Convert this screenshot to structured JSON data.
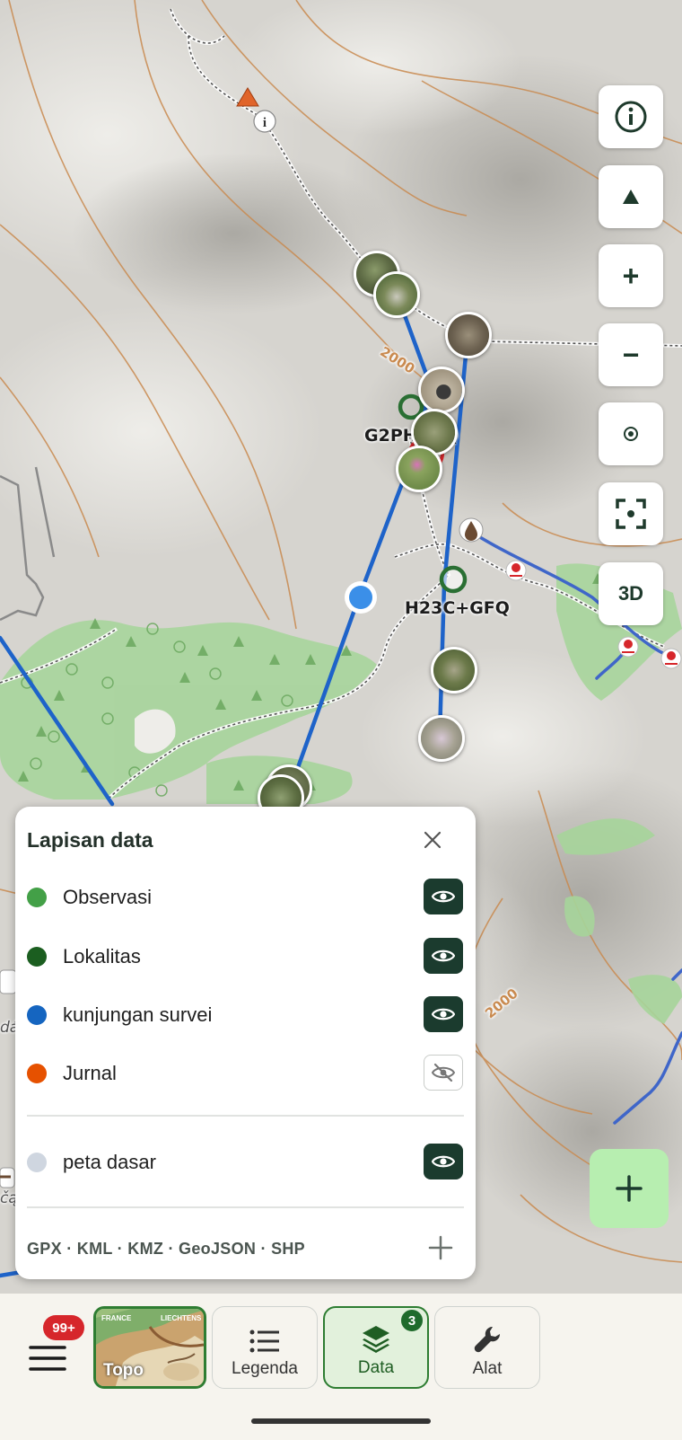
{
  "map": {
    "contour_label_1": "2000",
    "contour_label_2": "2000",
    "place_label_1": "G2PH+CQ",
    "place_label_2": "H23C+GFQ",
    "edge_text_1": "čą",
    "edge_text_2": "dá",
    "colors": {
      "track": "#1e63c9",
      "forest": "#a7d59b",
      "contour": "#c98a4f",
      "marker_green": "#2a6f33"
    }
  },
  "controls": {
    "info_icon": "info-icon",
    "north_icon": "north-arrow-icon",
    "zoom_in": "+",
    "zoom_out": "−",
    "locate_icon": "target-icon",
    "focus_icon": "focus-frame-icon",
    "three_d": "3D",
    "fab_icon": "plus-icon"
  },
  "panel": {
    "title": "Lapisan data",
    "layers": [
      {
        "name": "Observasi",
        "color": "#43a047",
        "visible": true
      },
      {
        "name": "Lokalitas",
        "color": "#1b5e20",
        "visible": true
      },
      {
        "name": "kunjungan survei",
        "color": "#1565c0",
        "visible": true
      },
      {
        "name": "Jurnal",
        "color": "#e65100",
        "visible": false
      }
    ],
    "base_layer": {
      "name": "peta dasar",
      "color": "#cfd6e0",
      "visible": true
    },
    "formats": "GPX · KML · KMZ · GeoJSON · SHP"
  },
  "bottom_nav": {
    "menu_badge": "99+",
    "topo_label": "Topo",
    "topo_thumb_text_1": "FRANCE",
    "topo_thumb_text_2": "LIECHTENS",
    "legend_label": "Legenda",
    "data_label": "Data",
    "data_badge": "3",
    "tools_label": "Alat"
  }
}
